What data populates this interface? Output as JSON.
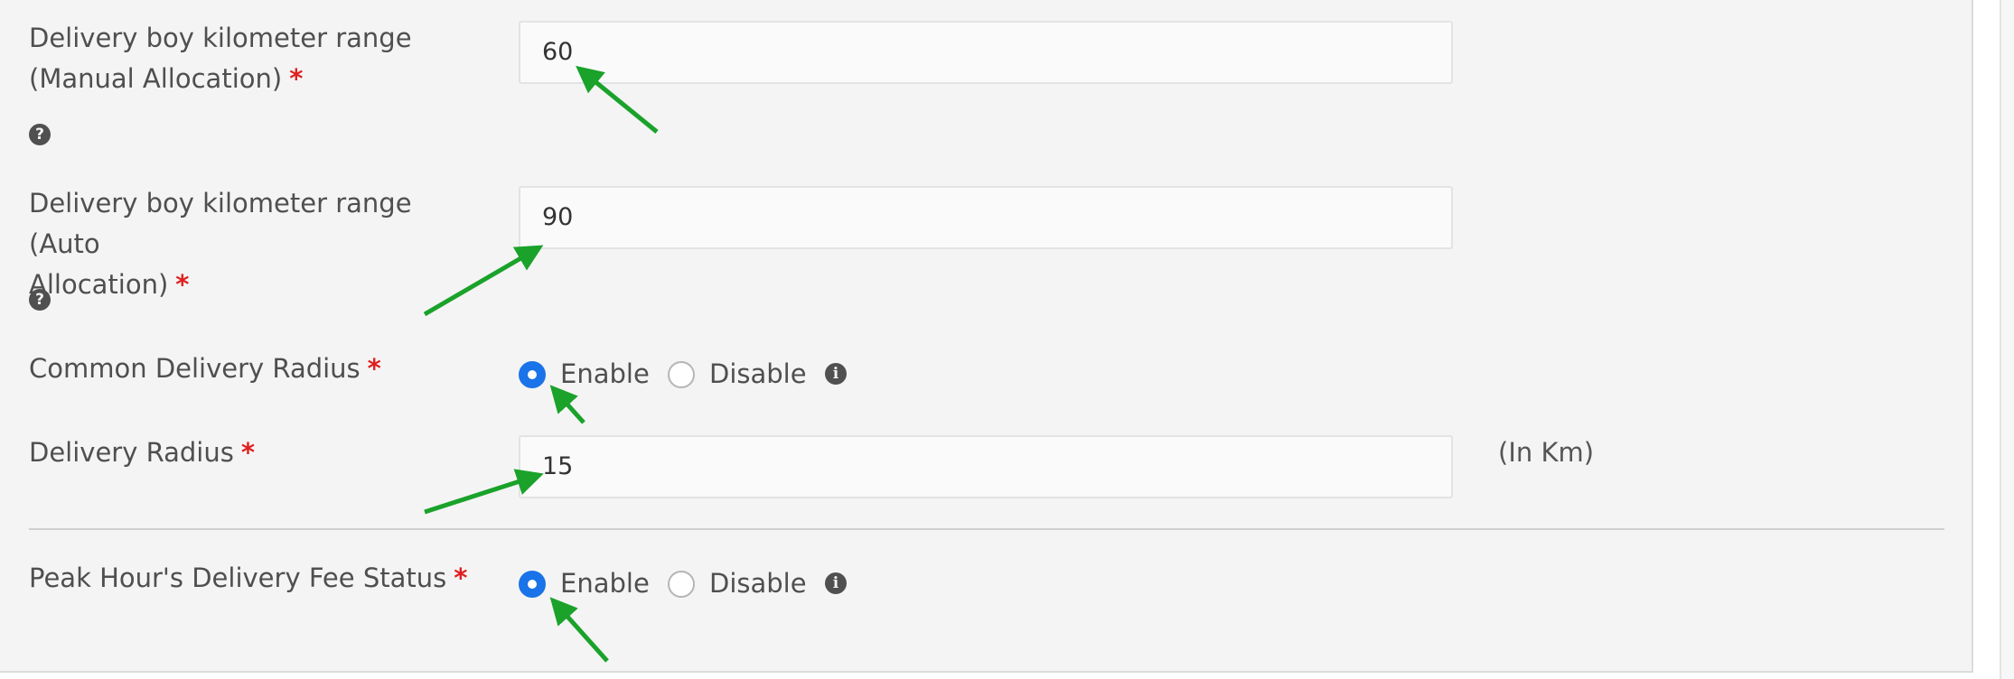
{
  "fields": {
    "manual_range": {
      "label_line1": "Delivery boy kilometer range",
      "label_line2": "(Manual Allocation)",
      "required": "*",
      "help_icon": "question-circle-icon",
      "value": "60"
    },
    "auto_range": {
      "label_line1": "Delivery boy kilometer range (Auto",
      "label_line2": "Allocation)",
      "required": "*",
      "help_icon": "question-circle-icon",
      "value": "90"
    },
    "common_radius": {
      "label": "Common Delivery Radius",
      "required": "*",
      "enable_label": "Enable",
      "disable_label": "Disable",
      "selected": "Enable",
      "info_icon": "info-circle-icon"
    },
    "delivery_radius": {
      "label": "Delivery Radius",
      "required": "*",
      "value": "15",
      "unit": "(In Km)"
    },
    "peak_fee_status": {
      "label": "Peak Hour's Delivery Fee Status",
      "required": "*",
      "enable_label": "Enable",
      "disable_label": "Disable",
      "selected": "Enable",
      "info_icon": "info-circle-icon"
    }
  },
  "colors": {
    "accent": "#1a73e8",
    "required": "#e02020",
    "annotation_arrow": "#1aa22a"
  }
}
